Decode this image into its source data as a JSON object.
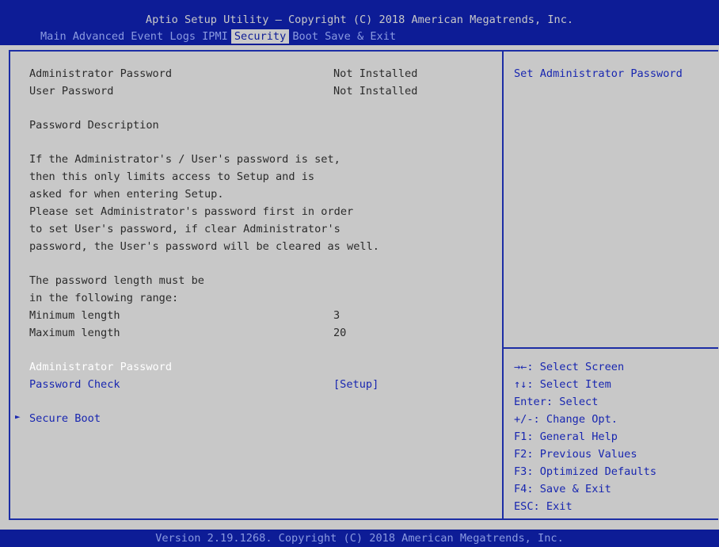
{
  "header": {
    "title": "Aptio Setup Utility – Copyright (C) 2018 American Megatrends, Inc.",
    "tabs": [
      "Main",
      "Advanced",
      "Event Logs",
      "IPMI",
      "Security",
      "Boot",
      "Save & Exit"
    ],
    "active_tab": "Security"
  },
  "main": {
    "admin_password_label": "Administrator Password",
    "admin_password_status": "Not Installed",
    "user_password_label": "User Password",
    "user_password_status": "Not Installed",
    "description_heading": "Password Description",
    "description_lines": [
      "If the Administrator's / User's password is set,",
      "then this only limits access to Setup and is",
      "asked for when entering Setup.",
      "Please set Administrator's password first in order",
      "to set User's password, if clear Administrator's",
      "password, the User's password will be cleared as well."
    ],
    "length_lines": [
      "The password length must be",
      "in the following range:"
    ],
    "min_length_label": "Minimum length",
    "min_length_value": "3",
    "max_length_label": "Maximum length",
    "max_length_value": "20",
    "admin_password_option": "Administrator Password",
    "password_check_label": "Password Check",
    "password_check_value": "[Setup]",
    "secure_boot_label": "Secure Boot",
    "secure_boot_arrow": "►"
  },
  "help": {
    "description": "Set Administrator Password",
    "keys": [
      "→←: Select Screen",
      "↑↓: Select Item",
      "Enter: Select",
      "+/-: Change Opt.",
      "F1: General Help",
      "F2: Previous Values",
      "F3: Optimized Defaults",
      "F4: Save & Exit",
      "ESC: Exit"
    ]
  },
  "footer": {
    "text": "Version 2.19.1268. Copyright (C) 2018 American Megatrends, Inc."
  },
  "colors": {
    "header_bg": "#0d1c96",
    "panel_bg": "#c8c8c8",
    "highlight_text": "#1826b0",
    "selected_text": "#ffffff"
  }
}
